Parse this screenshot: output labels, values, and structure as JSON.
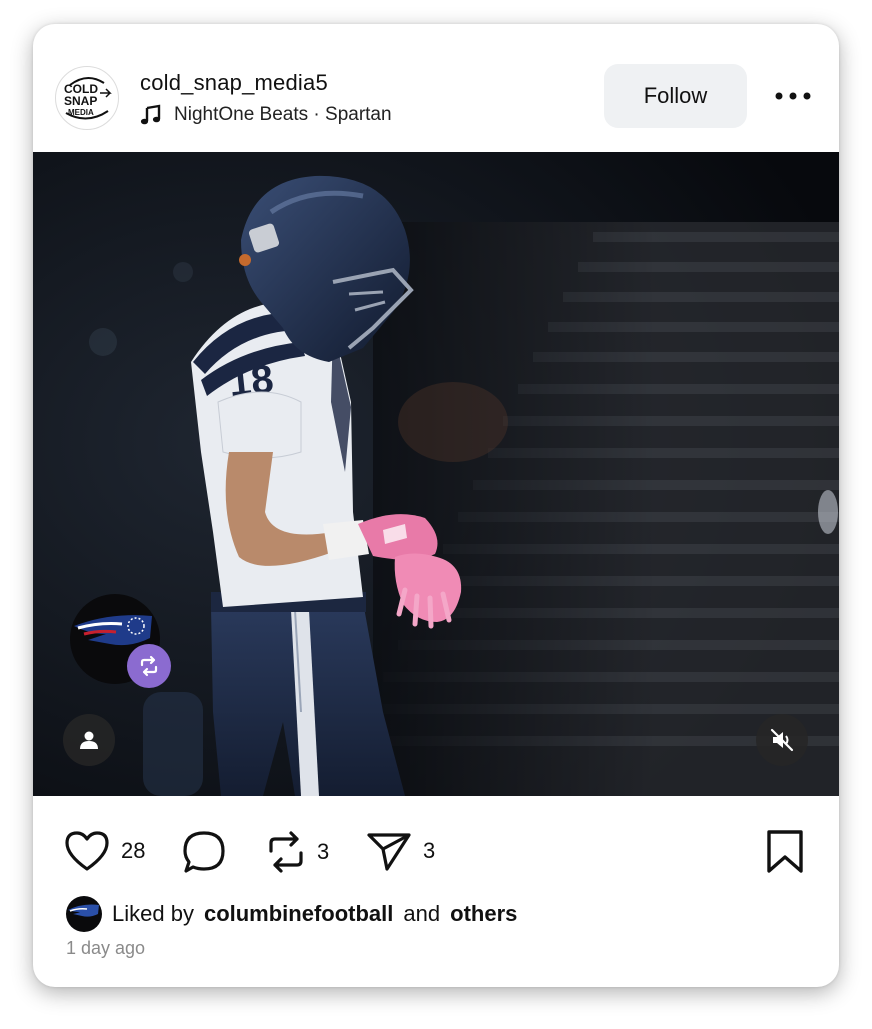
{
  "post": {
    "username": "cold_snap_media5",
    "avatar_logo": [
      "COLD",
      "SNAP",
      "MEDIA"
    ],
    "music": {
      "icon": "music-note-icon",
      "track": "NightOne Beats · Spartan"
    },
    "follow_label": "Follow",
    "more_icon": "more-horizontal-icon",
    "media": {
      "description_icons": [
        "user-tag-icon",
        "muted-speaker-icon",
        "repost-icon"
      ],
      "jersey_number": "18"
    }
  },
  "actions": {
    "like_icon": "heart-icon",
    "likes": "28",
    "comment_icon": "comment-bubble-icon",
    "repost_icon": "repost-icon",
    "reposts": "3",
    "share_icon": "send-icon",
    "shares": "3",
    "save_icon": "bookmark-icon"
  },
  "liked_by": {
    "prefix": "Liked by",
    "user": "columbinefootball",
    "conjunction": "and",
    "others": "others"
  },
  "timestamp": "1 day ago",
  "colors": {
    "follow_bg": "#eff1f3",
    "repost_badge": "#8b6bd0",
    "text": "#111111",
    "muted_text": "#8a8a8a"
  }
}
